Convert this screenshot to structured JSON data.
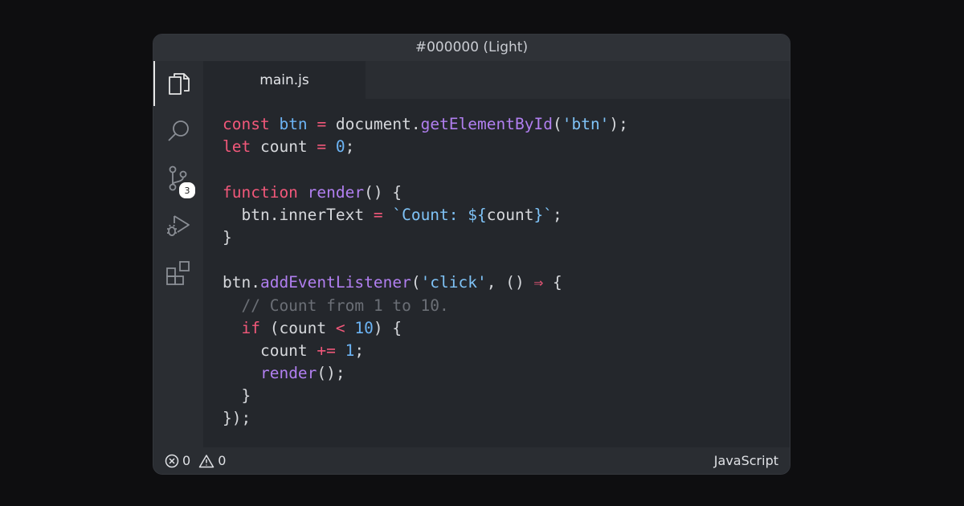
{
  "window": {
    "title": "#000000 (Light)"
  },
  "activity_bar": {
    "items": [
      {
        "icon": "files-icon",
        "active": true
      },
      {
        "icon": "search-icon",
        "active": false
      },
      {
        "icon": "source-control-icon",
        "active": false,
        "badge": "3"
      },
      {
        "icon": "run-debug-icon",
        "active": false
      },
      {
        "icon": "extensions-icon",
        "active": false
      }
    ]
  },
  "tabs": [
    {
      "label": "main.js",
      "active": true
    }
  ],
  "editor": {
    "language": "JavaScript",
    "lines": [
      [
        {
          "t": "const",
          "c": "kw"
        },
        {
          "t": " ",
          "c": "id"
        },
        {
          "t": "btn",
          "c": "var"
        },
        {
          "t": " ",
          "c": "id"
        },
        {
          "t": "=",
          "c": "kw"
        },
        {
          "t": " document.",
          "c": "id"
        },
        {
          "t": "getElementById",
          "c": "fn"
        },
        {
          "t": "(",
          "c": "id"
        },
        {
          "t": "'btn'",
          "c": "str"
        },
        {
          "t": ");",
          "c": "id"
        }
      ],
      [
        {
          "t": "let",
          "c": "kw"
        },
        {
          "t": " count ",
          "c": "id"
        },
        {
          "t": "=",
          "c": "kw"
        },
        {
          "t": " ",
          "c": "id"
        },
        {
          "t": "0",
          "c": "num"
        },
        {
          "t": ";",
          "c": "id"
        }
      ],
      [],
      [
        {
          "t": "function",
          "c": "kw"
        },
        {
          "t": " ",
          "c": "id"
        },
        {
          "t": "render",
          "c": "fn"
        },
        {
          "t": "() {",
          "c": "id"
        }
      ],
      [
        {
          "t": "  btn.innerText ",
          "c": "id"
        },
        {
          "t": "=",
          "c": "kw"
        },
        {
          "t": " ",
          "c": "id"
        },
        {
          "t": "`Count: ${",
          "c": "str"
        },
        {
          "t": "count",
          "c": "id"
        },
        {
          "t": "}`",
          "c": "str"
        },
        {
          "t": ";",
          "c": "id"
        }
      ],
      [
        {
          "t": "}",
          "c": "id"
        }
      ],
      [],
      [
        {
          "t": "btn.",
          "c": "id"
        },
        {
          "t": "addEventListener",
          "c": "fn"
        },
        {
          "t": "(",
          "c": "id"
        },
        {
          "t": "'click'",
          "c": "str"
        },
        {
          "t": ", () ",
          "c": "id"
        },
        {
          "t": "⇒",
          "c": "kw"
        },
        {
          "t": " {",
          "c": "id"
        }
      ],
      [
        {
          "t": "  ",
          "c": "id"
        },
        {
          "t": "// Count from 1 to 10.",
          "c": "cm"
        }
      ],
      [
        {
          "t": "  ",
          "c": "id"
        },
        {
          "t": "if",
          "c": "kw"
        },
        {
          "t": " (count ",
          "c": "id"
        },
        {
          "t": "<",
          "c": "kw"
        },
        {
          "t": " ",
          "c": "id"
        },
        {
          "t": "10",
          "c": "num"
        },
        {
          "t": ") {",
          "c": "id"
        }
      ],
      [
        {
          "t": "    count ",
          "c": "id"
        },
        {
          "t": "+=",
          "c": "kw"
        },
        {
          "t": " ",
          "c": "id"
        },
        {
          "t": "1",
          "c": "num"
        },
        {
          "t": ";",
          "c": "id"
        }
      ],
      [
        {
          "t": "    ",
          "c": "id"
        },
        {
          "t": "render",
          "c": "fn"
        },
        {
          "t": "();",
          "c": "id"
        }
      ],
      [
        {
          "t": "  }",
          "c": "id"
        }
      ],
      [
        {
          "t": "});",
          "c": "id"
        }
      ]
    ]
  },
  "status_bar": {
    "errors": "0",
    "warnings": "0",
    "language": "JavaScript"
  }
}
